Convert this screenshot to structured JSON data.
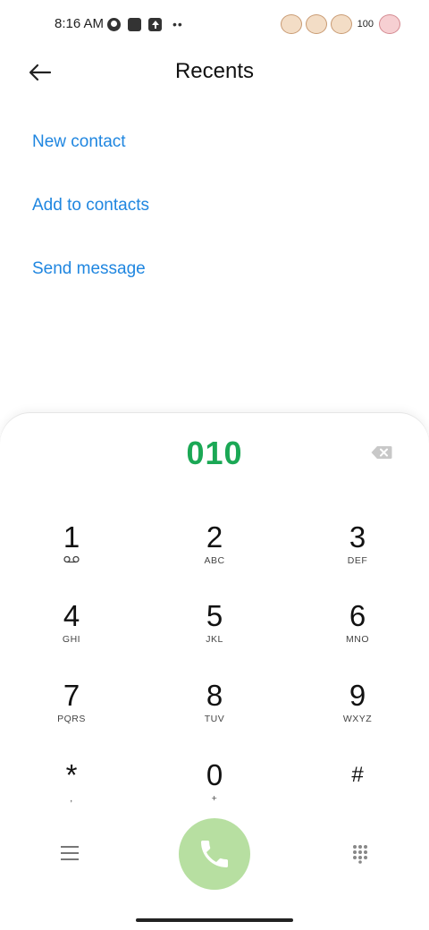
{
  "status_bar": {
    "time": "8:16 AM",
    "battery": "100",
    "dots": "••"
  },
  "header": {
    "title": "Recents"
  },
  "actions": [
    {
      "label": "New contact"
    },
    {
      "label": "Add to contacts"
    },
    {
      "label": "Send message"
    }
  ],
  "dialer": {
    "number": "010",
    "keys": [
      {
        "digit": "1",
        "letters": ""
      },
      {
        "digit": "2",
        "letters": "ABC"
      },
      {
        "digit": "3",
        "letters": "DEF"
      },
      {
        "digit": "4",
        "letters": "GHI"
      },
      {
        "digit": "5",
        "letters": "JKL"
      },
      {
        "digit": "6",
        "letters": "MNO"
      },
      {
        "digit": "7",
        "letters": "PQRS"
      },
      {
        "digit": "8",
        "letters": "TUV"
      },
      {
        "digit": "9",
        "letters": "WXYZ"
      },
      {
        "digit": "*",
        "letters": ","
      },
      {
        "digit": "0",
        "letters": "+"
      },
      {
        "digit": "#",
        "letters": ""
      }
    ]
  },
  "colors": {
    "accent_blue": "#1f86e0",
    "number_green": "#1ba855",
    "call_button": "#b7dfa1"
  },
  "icons": [
    "back-arrow-icon",
    "backspace-icon",
    "voicemail-icon",
    "menu-icon",
    "phone-icon",
    "keypad-icon"
  ]
}
